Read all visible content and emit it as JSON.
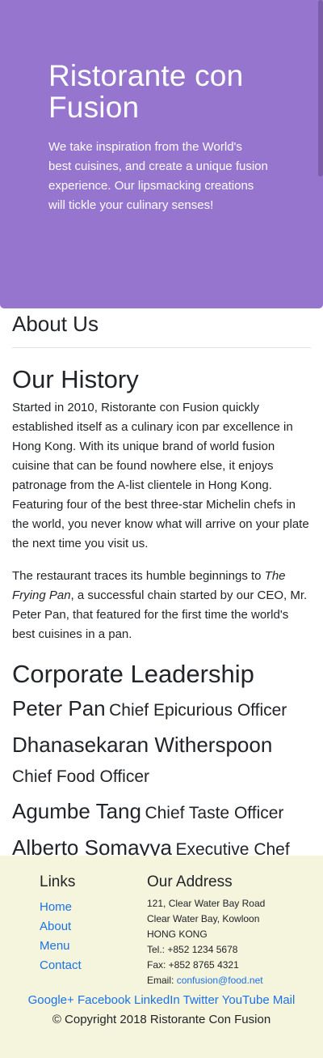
{
  "hero": {
    "title": "Ristorante con Fusion",
    "description": "We take inspiration from the World's best cuisines, and create a unique fusion experience. Our lipsmacking creations will tickle your culinary senses!"
  },
  "about": {
    "title": "About Us",
    "history_title": "Our History",
    "history_p1": "Started in 2010, Ristorante con Fusion quickly established itself as a culinary icon par excellence in Hong Kong. With its unique brand of world fusion cuisine that can be found nowhere else, it enjoys patronage from the A-list clientele in Hong Kong. Featuring four of the best three-star Michelin chefs in the world, you never know what will arrive on your plate the next time you visit us.",
    "history_p2_pre": "The restaurant traces its humble beginnings to ",
    "history_p2_em": "The Frying Pan",
    "history_p2_post": ", a successful chain started by our CEO, Mr. Peter Pan, that featured for the first time the world's best cuisines in a pan.",
    "leadership_title": "Corporate Leadership",
    "leaders": [
      {
        "name": "Peter Pan",
        "role": "Chief Epicurious Officer"
      },
      {
        "name": "Dhanasekaran Witherspoon",
        "role": "Chief Food Officer"
      },
      {
        "name": "Agumbe Tang",
        "role": "Chief Taste Officer"
      },
      {
        "name": "Alberto Somayya",
        "role": "Executive Chef"
      }
    ]
  },
  "footer": {
    "links_title": "Links",
    "links": [
      "Home",
      "About",
      "Menu",
      "Contact"
    ],
    "address_title": "Our Address",
    "address_lines": [
      "121, Clear Water Bay Road",
      "Clear Water Bay, Kowloon",
      "HONG KONG",
      "Tel.: +852 1234 5678",
      "Fax: +852 8765 4321"
    ],
    "email_label": "Email: ",
    "email": "confusion@food.net",
    "social": [
      "Google+",
      "Facebook",
      "LinkedIn",
      "Twitter",
      "YouTube",
      "Mail"
    ],
    "copyright": "© Copyright 2018 Ristorante Con Fusion"
  },
  "colors": {
    "hero_bg": "#9575cd",
    "footer_bg": "#f5f4dc",
    "link": "#1a73e8"
  }
}
